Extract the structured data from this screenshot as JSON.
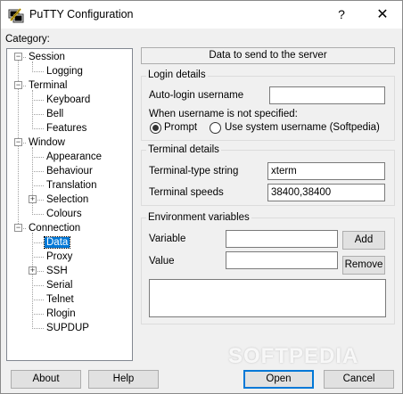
{
  "window": {
    "title": "PuTTY Configuration",
    "help_glyph": "?",
    "close_glyph": "✕"
  },
  "category": {
    "label": "Category:",
    "items": [
      {
        "label": "Session",
        "level": 0,
        "expander": "−"
      },
      {
        "label": "Logging",
        "level": 1
      },
      {
        "label": "Terminal",
        "level": 0,
        "expander": "−"
      },
      {
        "label": "Keyboard",
        "level": 1
      },
      {
        "label": "Bell",
        "level": 1
      },
      {
        "label": "Features",
        "level": 1
      },
      {
        "label": "Window",
        "level": 0,
        "expander": "−"
      },
      {
        "label": "Appearance",
        "level": 1
      },
      {
        "label": "Behaviour",
        "level": 1
      },
      {
        "label": "Translation",
        "level": 1
      },
      {
        "label": "Selection",
        "level": 1,
        "expander": "+"
      },
      {
        "label": "Colours",
        "level": 1
      },
      {
        "label": "Connection",
        "level": 0,
        "expander": "−"
      },
      {
        "label": "Data",
        "level": 1,
        "selected": true
      },
      {
        "label": "Proxy",
        "level": 1
      },
      {
        "label": "SSH",
        "level": 1,
        "expander": "+"
      },
      {
        "label": "Serial",
        "level": 1
      },
      {
        "label": "Telnet",
        "level": 1
      },
      {
        "label": "Rlogin",
        "level": 1
      },
      {
        "label": "SUPDUP",
        "level": 1
      }
    ]
  },
  "panel": {
    "header": "Data to send to the server",
    "login": {
      "title": "Login details",
      "autologin_label": "Auto-login username",
      "autologin_value": "",
      "unspecified_label": "When username is not specified:",
      "prompt_label": "Prompt",
      "prompt_checked": true,
      "system_label": "Use system username (Softpedia)",
      "system_checked": false
    },
    "terminal": {
      "title": "Terminal details",
      "type_label": "Terminal-type string",
      "type_value": "xterm",
      "speeds_label": "Terminal speeds",
      "speeds_value": "38400,38400"
    },
    "env": {
      "title": "Environment variables",
      "variable_label": "Variable",
      "variable_value": "",
      "value_label": "Value",
      "value_value": "",
      "add_label": "Add",
      "remove_label": "Remove"
    }
  },
  "footer": {
    "about_label": "About",
    "help_label": "Help",
    "open_label": "Open",
    "cancel_label": "Cancel"
  },
  "watermark": "SOFTPEDIA"
}
